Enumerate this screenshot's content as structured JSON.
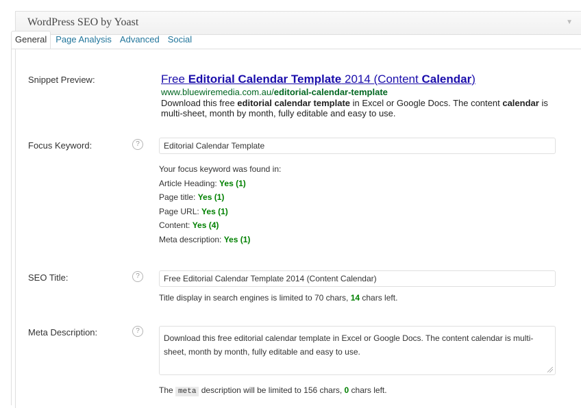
{
  "metabox": {
    "title": "WordPress SEO by Yoast",
    "toggle_icon": "triangle-down-icon"
  },
  "tabs": [
    {
      "label": "General",
      "active": true
    },
    {
      "label": "Page Analysis",
      "active": false
    },
    {
      "label": "Advanced",
      "active": false
    },
    {
      "label": "Social",
      "active": false
    }
  ],
  "help_icon_glyph": "?",
  "snippet": {
    "label": "Snippet Preview:",
    "title_parts": [
      "Free ",
      "Editorial Calendar Template",
      " 2014 (Content ",
      "Calendar",
      ")"
    ],
    "url_parts": [
      "www.bluewiremedia.com.au/",
      "editorial-calendar-template"
    ],
    "desc_parts": [
      "Download this free ",
      "editorial calendar template",
      " in Excel or Google Docs. The content ",
      "calendar",
      " is multi-sheet, month by month, fully editable and easy to use."
    ]
  },
  "focus_keyword": {
    "label": "Focus Keyword:",
    "value": "Editorial Calendar Template",
    "found_intro": "Your focus keyword was found in:",
    "results": [
      {
        "label": "Article Heading: ",
        "result": "Yes (1)"
      },
      {
        "label": "Page title: ",
        "result": "Yes (1)"
      },
      {
        "label": "Page URL: ",
        "result": "Yes (1)"
      },
      {
        "label": "Content: ",
        "result": "Yes (4)"
      },
      {
        "label": "Meta description: ",
        "result": "Yes (1)"
      }
    ]
  },
  "seo_title": {
    "label": "SEO Title:",
    "value": "Free Editorial Calendar Template 2014 (Content Calendar)",
    "note_before": "Title display in search engines is limited to 70 chars, ",
    "chars_left": "14",
    "note_after": " chars left."
  },
  "meta_description": {
    "label": "Meta Description:",
    "value": "Download this free editorial calendar template in Excel or Google Docs. The content calendar is multi-sheet, month by month, fully editable and easy to use.",
    "note_before": "The ",
    "note_code": "meta",
    "note_middle": " description will be limited to 156 chars, ",
    "chars_left": "0",
    "note_after": " chars left."
  },
  "colors": {
    "link": "#1a0dab",
    "url_green": "#006621",
    "good_green": "#008000",
    "tab_link": "#21759b"
  }
}
